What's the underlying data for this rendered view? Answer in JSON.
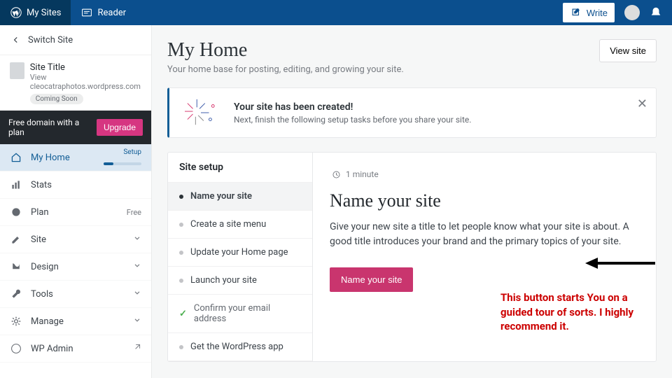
{
  "topbar": {
    "mysites": "My Sites",
    "reader": "Reader",
    "write": "Write"
  },
  "sidebar": {
    "switch": "Switch Site",
    "site": {
      "title": "Site Title",
      "url": "View cleocatraphotos.wordpress.com",
      "badge": "Coming Soon"
    },
    "promo": {
      "text": "Free domain with a plan",
      "cta": "Upgrade"
    },
    "items": [
      {
        "icon": "home",
        "label": "My Home",
        "setup": "Setup",
        "selected": true
      },
      {
        "icon": "stats",
        "label": "Stats"
      },
      {
        "icon": "plan",
        "label": "Plan",
        "right": "Free"
      },
      {
        "icon": "pencil",
        "label": "Site",
        "chev": true
      },
      {
        "icon": "design",
        "label": "Design",
        "chev": true
      },
      {
        "icon": "wrench",
        "label": "Tools",
        "chev": true
      },
      {
        "icon": "gear",
        "label": "Manage",
        "chev": true
      },
      {
        "icon": "wp",
        "label": "WP Admin",
        "ext": true
      }
    ]
  },
  "header": {
    "title": "My Home",
    "subtitle": "Your home base for posting, editing, and growing your site.",
    "viewsite": "View site"
  },
  "banner": {
    "title": "Your site has been created!",
    "text": "Next, finish the following setup tasks before you share your site."
  },
  "setup": {
    "title": "Site setup",
    "steps": [
      {
        "label": "Name your site",
        "state": "active"
      },
      {
        "label": "Create a site menu",
        "state": "todo"
      },
      {
        "label": "Update your Home page",
        "state": "todo"
      },
      {
        "label": "Launch your site",
        "state": "todo"
      },
      {
        "label": "Confirm your email address",
        "state": "done"
      },
      {
        "label": "Get the WordPress app",
        "state": "todo"
      }
    ],
    "detail": {
      "time": "1 minute",
      "heading": "Name your site",
      "body": "Give your new site a title to let people know what your site is about. A good title introduces your brand and the primary topics of your site.",
      "cta": "Name your site"
    }
  },
  "annotation": "This button starts You on a guided tour of sorts. I highly recommend it."
}
